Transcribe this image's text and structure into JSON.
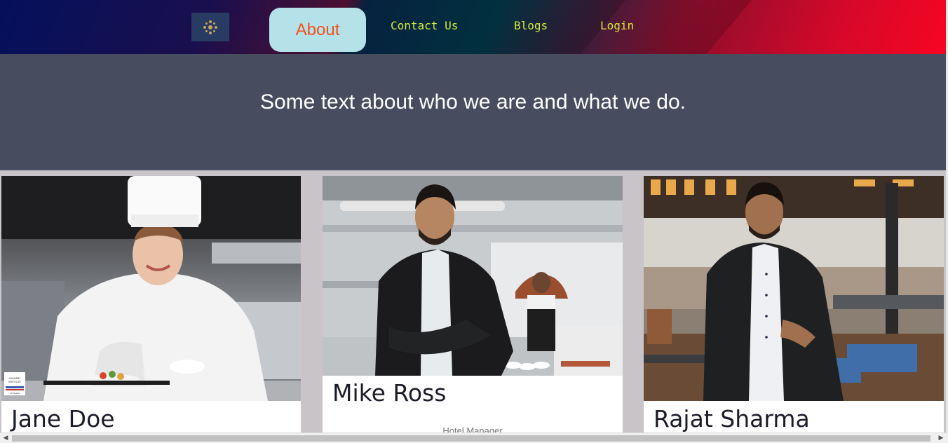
{
  "navbar": {
    "logo_icon": "ornament-logo-icon",
    "items": [
      {
        "label": "About",
        "active": true
      },
      {
        "label": "Contact Us"
      },
      {
        "label": "Blogs"
      },
      {
        "label": "Login"
      }
    ],
    "active_bg": "#b5e2e8",
    "active_color": "#f4511e",
    "link_color": "#d8e83a"
  },
  "hero": {
    "text": "Some text about who we are and what we do."
  },
  "team": [
    {
      "name": "Jane Doe",
      "photo_icon": "chef-photo",
      "badge": "CULINARY INSTITUTE of Virginia"
    },
    {
      "name": "Mike Ross",
      "role": "Hotel Manager",
      "photo_icon": "manager-photo"
    },
    {
      "name": "Rajat Sharma",
      "photo_icon": "restaurant-owner-photo"
    }
  ],
  "colors": {
    "hero_bg": "#474d5e",
    "page_bg": "#c9c4c8"
  }
}
